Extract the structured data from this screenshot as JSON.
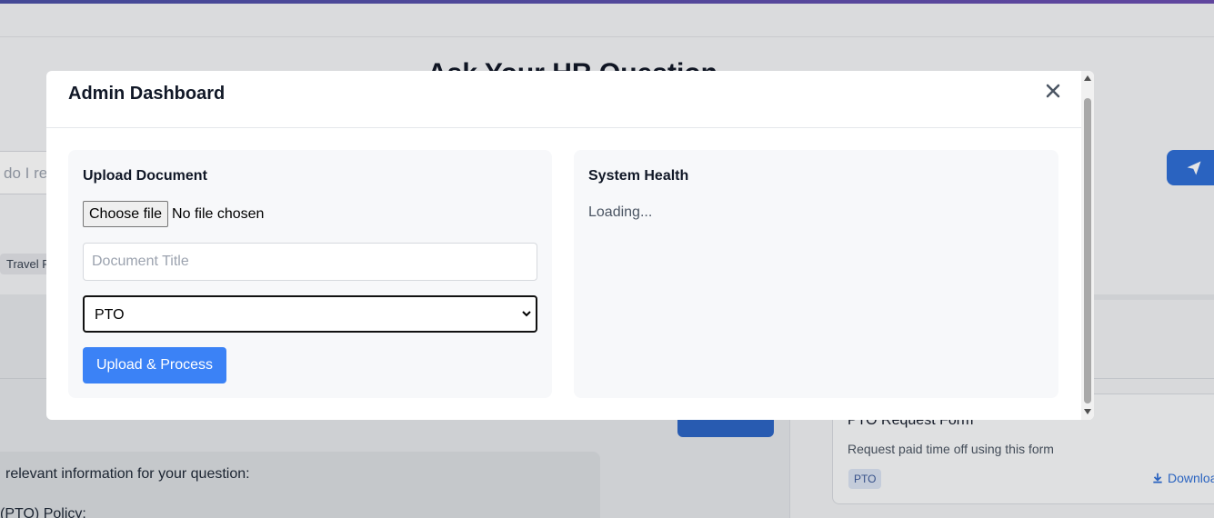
{
  "background": {
    "page_title": "Ask Your HR Question",
    "question_placeholder": "do I re",
    "category_chip": "Travel P",
    "answer_intro": "relevant information for your question:",
    "answer_line2": "(PTO) Policy:",
    "resource_card": {
      "title": "PTO Request Form",
      "description": "Request paid time off using this form",
      "tag": "PTO",
      "download_label": "Downloa"
    }
  },
  "modal": {
    "title": "Admin Dashboard",
    "close_icon": "close-icon",
    "upload": {
      "heading": "Upload Document",
      "file_button": "Choose file",
      "file_status": "No file chosen",
      "title_placeholder": "Document Title",
      "category_selected": "PTO",
      "submit_label": "Upload & Process",
      "submit_color": "#3b82f6"
    },
    "health": {
      "heading": "System Health",
      "status": "Loading..."
    }
  }
}
